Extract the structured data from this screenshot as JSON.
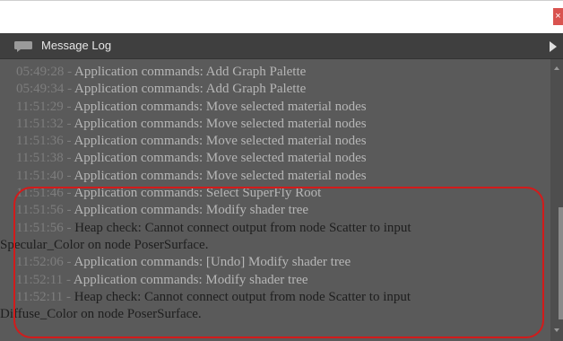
{
  "window": {
    "close_icon": "close-icon",
    "close_glyph": "×",
    "accent_close": "#d9534f"
  },
  "panel": {
    "title": "Message Log",
    "icon": "speech-bubble-icon",
    "expand_icon": "triangle-right-icon"
  },
  "log": [
    {
      "time": "05:49:28",
      "sep": " - ",
      "text": "Application commands: Add Graph Palette",
      "kind": "command"
    },
    {
      "time": "05:49:34",
      "sep": " - ",
      "text": "Application commands: Add Graph Palette",
      "kind": "command"
    },
    {
      "time": "11:51:29",
      "sep": " - ",
      "text": "Application commands: Move selected material nodes",
      "kind": "command"
    },
    {
      "time": "11:51:32",
      "sep": " - ",
      "text": "Application commands: Move selected material nodes",
      "kind": "command"
    },
    {
      "time": "11:51:36",
      "sep": " - ",
      "text": "Application commands: Move selected material nodes",
      "kind": "command"
    },
    {
      "time": "11:51:38",
      "sep": " - ",
      "text": "Application commands: Move selected material nodes",
      "kind": "command"
    },
    {
      "time": "11:51:40",
      "sep": " - ",
      "text": "Application commands: Move selected material nodes",
      "kind": "command"
    },
    {
      "time": "11:51:46",
      "sep": " - ",
      "text": "Application commands: Select SuperFly Root",
      "kind": "command"
    },
    {
      "time": "11:51:56",
      "sep": " - ",
      "text": "Application commands: Modify shader tree",
      "kind": "command"
    },
    {
      "time": "11:51:56",
      "sep": " - ",
      "text": "Heap check: Cannot connect output from node Scatter to input",
      "cont": "Specular_Color on node PoserSurface.",
      "kind": "heap"
    },
    {
      "time": "11:52:06",
      "sep": " - ",
      "text": "Application commands: [Undo] Modify shader tree",
      "kind": "command"
    },
    {
      "time": "11:52:11",
      "sep": " - ",
      "text": "Application commands: Modify shader tree",
      "kind": "command"
    },
    {
      "time": "11:52:11",
      "sep": " - ",
      "text": "Heap check: Cannot connect output from node Scatter to input",
      "cont": "Diffuse_Color on node PoserSurface.",
      "kind": "heap"
    }
  ],
  "colors": {
    "header_bg": "#3f3f3f",
    "log_bg": "#5a5a5a",
    "timestamp": "#7d7d7d",
    "command_text": "#b6b6b6",
    "heap_text": "#1e1e1e",
    "highlight": "#d21b1b"
  }
}
